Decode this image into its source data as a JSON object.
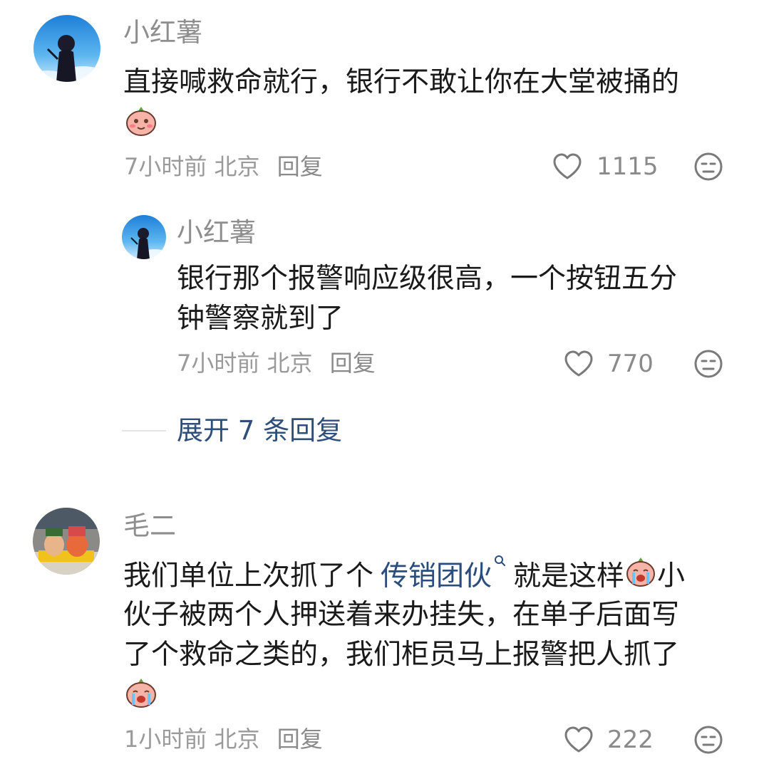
{
  "comments": [
    {
      "username": "小红薯",
      "text_line1": "直接喊救命就行，银行不敢让你在大堂被捅的",
      "emoji": "tearful-blush-sticker",
      "time": "7小时前",
      "location": "北京",
      "reply_label": "回复",
      "likes": "1115"
    },
    {
      "username": "小红薯",
      "text_line1": "银行那个报警响应级很高，一个按钮五分",
      "text_line2": "钟警察就到了",
      "time": "7小时前",
      "location": "北京",
      "reply_label": "回复",
      "likes": "770",
      "is_reply": true
    },
    {
      "username": "毛二",
      "text_line1_pre": "我们单位上次抓了个",
      "text_line1_link": "传销团伙",
      "text_line1_post": "就是这样",
      "text_line1_tail": "小",
      "text_line2": "伙子被两个人押送着来办挂失，在单子后面写",
      "text_line3": "了个救命之类的，我们柜员马上报警把人抓了",
      "emoji": "crying-sticker",
      "time": "1小时前",
      "location": "北京",
      "reply_label": "回复",
      "likes": "222"
    }
  ],
  "expand_replies": "展开 7 条回复",
  "icons": {
    "like": "heart-outline-icon",
    "dislike": "meh-face-icon",
    "search_link": "search-icon"
  },
  "colors": {
    "text": "#1a1a1a",
    "meta": "#9a9a9a",
    "link": "#2b4d7c"
  }
}
